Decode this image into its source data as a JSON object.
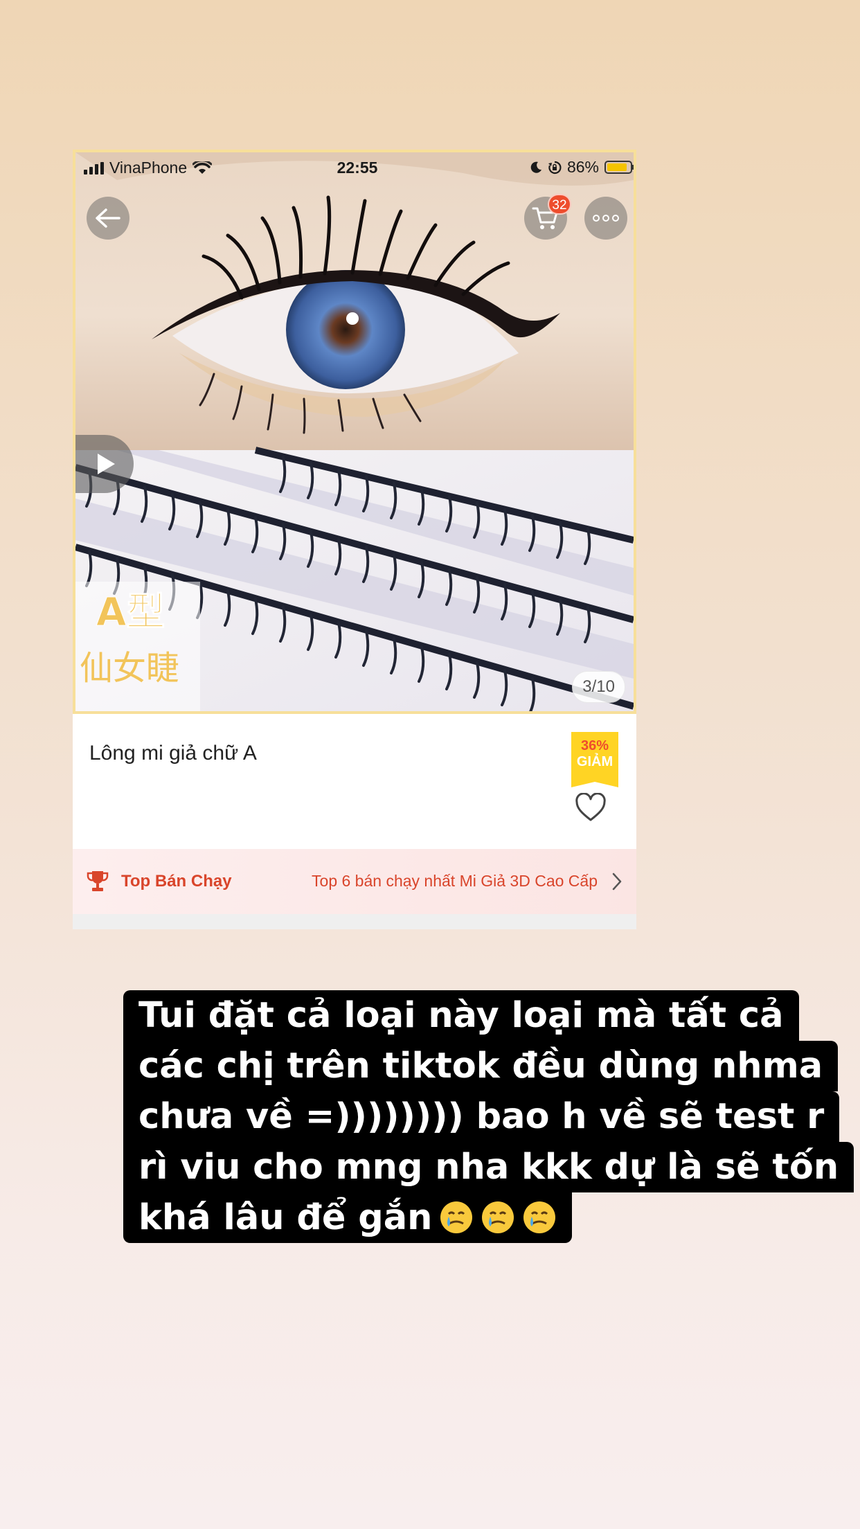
{
  "status_bar": {
    "carrier": "VinaPhone",
    "time": "22:55",
    "battery_pct": "86%",
    "battery_level": 0.86
  },
  "gallery": {
    "watermark_line1": "A型",
    "watermark_line2": "仙女睫",
    "pager": "3/10"
  },
  "header": {
    "cart_count": "32"
  },
  "product": {
    "name": "Lông mi giả chữ A",
    "discount_pct": "36%",
    "discount_label": "GIẢM"
  },
  "top_seller": {
    "label": "Top Bán Chạy",
    "description": "Top 6 bán chạy nhất Mi Giả 3D Cao Cấp"
  },
  "caption": {
    "lines": [
      "Tui đặt cả loại này loại mà tất cả",
      "các chị trên tiktok đều dùng nhma",
      "chưa về =)))))))) bao h về sẽ test r",
      "rì viu cho mng nha kkk dự là sẽ tốn",
      "khá lâu để gắn"
    ],
    "emoji_icons": [
      "crying-smile-icon",
      "crying-smile-icon",
      "crying-smile-icon"
    ]
  },
  "colors": {
    "shop_orange": "#ee4d2d",
    "discount_yellow": "#ffd424",
    "gallery_border": "#f7df9a",
    "caption_background": "#000000"
  }
}
